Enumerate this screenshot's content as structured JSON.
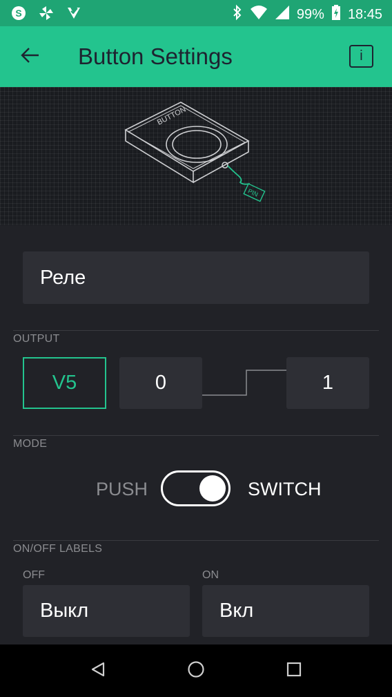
{
  "status_bar": {
    "left_icons": [
      "skype-icon",
      "pinwheel-icon",
      "check-badge-icon"
    ],
    "battery": "99%",
    "time": "18:45"
  },
  "app_bar": {
    "title": "Button Settings",
    "info_label": "i"
  },
  "illustration": {
    "device_label": "BUTTON",
    "pin_label": "PIN"
  },
  "widget": {
    "name": "Реле"
  },
  "output": {
    "section_label": "OUTPUT",
    "pin": "V5",
    "low_value": "0",
    "high_value": "1"
  },
  "mode": {
    "section_label": "MODE",
    "push_label": "PUSH",
    "switch_label": "SWITCH",
    "selected": "SWITCH"
  },
  "labels": {
    "section_label": "ON/OFF LABELS",
    "off_caption": "OFF",
    "on_caption": "ON",
    "off_value": "Выкл",
    "on_value": "Вкл"
  },
  "colors": {
    "accent": "#23c48e",
    "status_bar": "#1fa574",
    "background": "#212227",
    "field": "#2e2f35"
  }
}
